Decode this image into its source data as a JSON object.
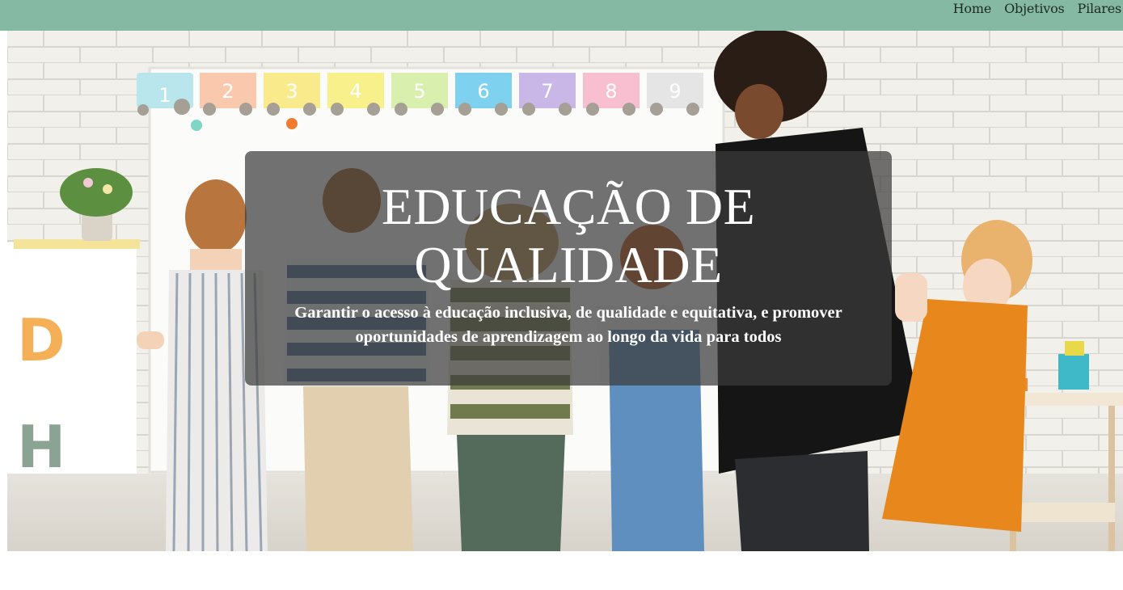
{
  "nav": {
    "items": [
      {
        "label": "Home"
      },
      {
        "label": "Objetivos"
      },
      {
        "label": "Pilares"
      }
    ]
  },
  "hero": {
    "title": "EDUCAÇÃO DE QUALIDADE",
    "subtitle": "Garantir o acesso à educação inclusiva, de qualidade e equitativa, e promover oportunidades de aprendizagem ao longo da vida para todos",
    "train_numbers": [
      "1",
      "2",
      "3",
      "4",
      "5",
      "6",
      "7",
      "8",
      "9"
    ],
    "wall_letters": [
      "D",
      "H"
    ]
  },
  "colors": {
    "navbar": "#86b9a3",
    "overlay": "rgba(60,60,60,0.72)",
    "text_light": "#ffffff"
  }
}
